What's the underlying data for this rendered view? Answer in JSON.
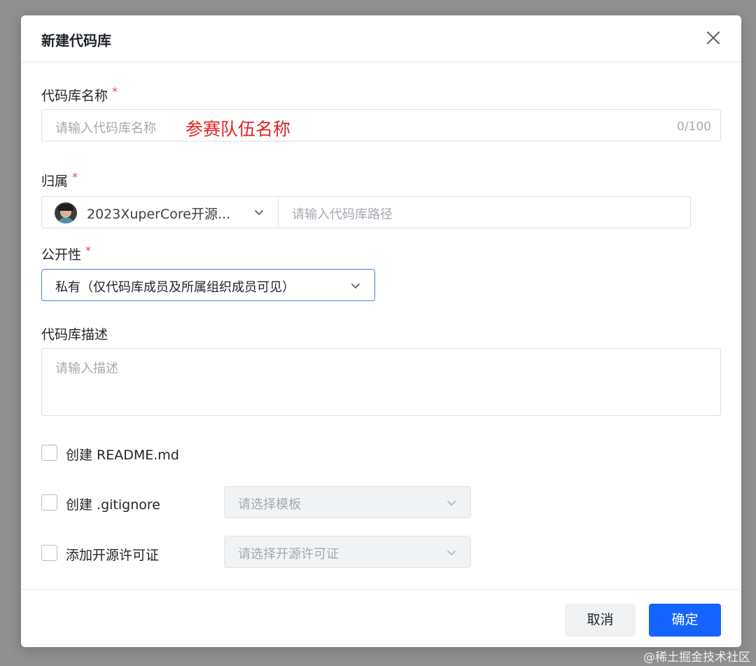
{
  "dialog": {
    "title": "新建代码库",
    "close_icon": "close-icon"
  },
  "name_field": {
    "label": "代码库名称",
    "required_mark": "*",
    "placeholder": "请输入代码库名称",
    "annotation": "参赛队伍名称",
    "counter": "0/100"
  },
  "owner_field": {
    "label": "归属",
    "required_mark": "*",
    "selected_owner": "2023XuperCore开源...",
    "path_placeholder": "请输入代码库路径"
  },
  "visibility_field": {
    "label": "公开性",
    "required_mark": "*",
    "selected": "私有（仅代码库成员及所属组织成员可见）"
  },
  "description_field": {
    "label": "代码库描述",
    "placeholder": "请输入描述"
  },
  "options": {
    "readme": {
      "label": "创建 README.md",
      "checked": false
    },
    "gitignore": {
      "label": "创建 .gitignore",
      "checked": false,
      "select_placeholder": "请选择模板"
    },
    "license": {
      "label": "添加开源许可证",
      "checked": false,
      "select_placeholder": "请选择开源许可证"
    }
  },
  "footer": {
    "cancel_label": "取消",
    "confirm_label": "确定"
  },
  "watermark": "@稀土掘金技术社区",
  "colors": {
    "primary": "#1664ff",
    "required": "#e0454b",
    "annotation": "#e02323",
    "focus_border": "#4a7fe0"
  }
}
